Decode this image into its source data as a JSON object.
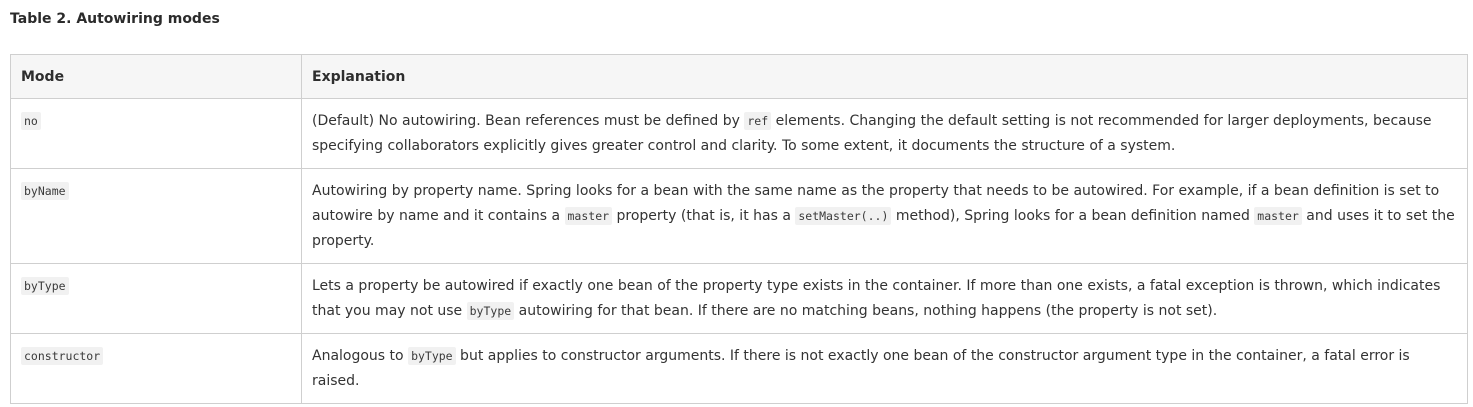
{
  "caption": "Table 2. Autowiring modes",
  "headers": {
    "mode": "Mode",
    "explanation": "Explanation"
  },
  "rows": [
    {
      "mode": "no",
      "explanation": [
        {
          "t": "text",
          "v": "(Default) No autowiring. Bean references must be defined by "
        },
        {
          "t": "code",
          "v": "ref"
        },
        {
          "t": "text",
          "v": " elements. Changing the default setting is not recommended for larger deployments, because specifying collaborators explicitly gives greater control and clarity. To some extent, it documents the structure of a system."
        }
      ]
    },
    {
      "mode": "byName",
      "explanation": [
        {
          "t": "text",
          "v": "Autowiring by property name. Spring looks for a bean with the same name as the property that needs to be autowired. For example, if a bean definition is set to autowire by name and it contains a "
        },
        {
          "t": "code",
          "v": "master"
        },
        {
          "t": "text",
          "v": " property (that is, it has a "
        },
        {
          "t": "code",
          "v": "setMaster(..)"
        },
        {
          "t": "text",
          "v": " method), Spring looks for a bean definition named "
        },
        {
          "t": "code",
          "v": "master"
        },
        {
          "t": "text",
          "v": " and uses it to set the property."
        }
      ]
    },
    {
      "mode": "byType",
      "explanation": [
        {
          "t": "text",
          "v": "Lets a property be autowired if exactly one bean of the property type exists in the container. If more than one exists, a fatal exception is thrown, which indicates that you may not use "
        },
        {
          "t": "code",
          "v": "byType"
        },
        {
          "t": "text",
          "v": " autowiring for that bean. If there are no matching beans, nothing happens (the property is not set)."
        }
      ]
    },
    {
      "mode": "constructor",
      "explanation": [
        {
          "t": "text",
          "v": "Analogous to "
        },
        {
          "t": "code",
          "v": "byType"
        },
        {
          "t": "text",
          "v": " but applies to constructor arguments. If there is not exactly one bean of the constructor argument type in the container, a fatal error is raised."
        }
      ]
    }
  ]
}
